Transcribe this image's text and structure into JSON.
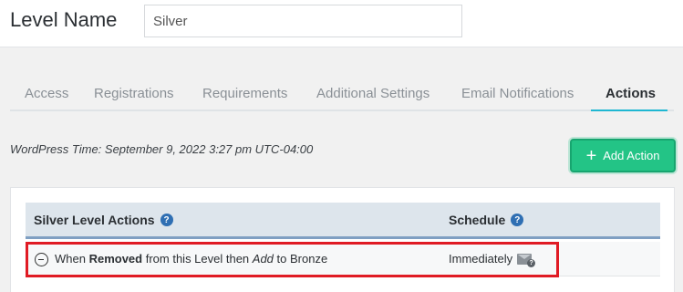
{
  "header": {
    "label": "Level Name",
    "input_value": "Silver"
  },
  "tabs": [
    {
      "label": "Access",
      "active": false
    },
    {
      "label": "Registrations",
      "active": false
    },
    {
      "label": "Requirements",
      "active": false
    },
    {
      "label": "Additional Settings",
      "active": false
    },
    {
      "label": "Email Notifications",
      "active": false
    },
    {
      "label": "Actions",
      "active": true
    }
  ],
  "wp_time": "WordPress Time: September 9, 2022 3:27 pm UTC-04:00",
  "add_action": {
    "label": "Add Action",
    "icon": "plus-icon"
  },
  "table": {
    "columns": [
      {
        "label": "Silver Level Actions",
        "help_icon": "?"
      },
      {
        "label": "Schedule",
        "help_icon": "?"
      }
    ],
    "rows": [
      {
        "prefix": "When ",
        "event": "Removed",
        "middle": " from this Level then ",
        "action": "Add",
        "suffix": " to Bronze",
        "schedule": "Immediately",
        "schedule_icon": "mail-question-icon",
        "mail_q": "?"
      }
    ]
  },
  "colors": {
    "accent": "#1fb7d2",
    "button": "#23c486",
    "help": "#2f6fb3",
    "highlight": "#e01b24"
  }
}
